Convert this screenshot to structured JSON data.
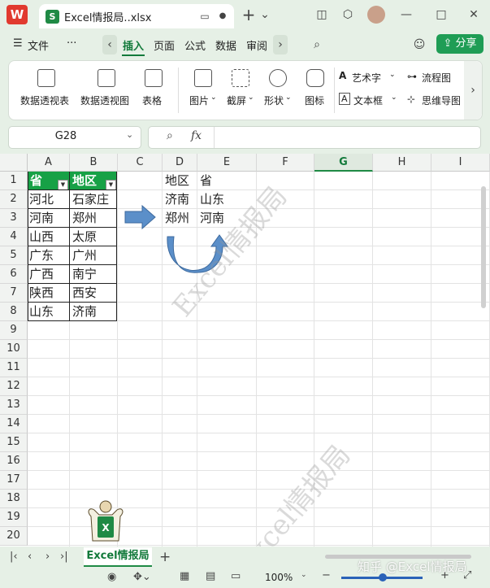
{
  "app": {
    "logo_letter": "W",
    "file_icon_letter": "S",
    "file_tab_title": "Excel情报局..xlsx",
    "new_tab_symbol": "+",
    "new_tab_menu": "⌄"
  },
  "menubar": {
    "hamburger": "☰",
    "file": "文件",
    "more": "···",
    "tabs": [
      "插入",
      "页面",
      "公式",
      "数据",
      "审阅"
    ],
    "active_tab": "插入",
    "share": "分享"
  },
  "ribbon": {
    "items": [
      {
        "label": "数据透视表",
        "icon": "pivot-table-icon"
      },
      {
        "label": "数据透视图",
        "icon": "pivot-chart-icon"
      },
      {
        "label": "表格",
        "icon": "table-icon"
      },
      {
        "label": "图片",
        "icon": "picture-icon"
      },
      {
        "label": "截屏",
        "icon": "screenshot-icon"
      },
      {
        "label": "形状",
        "icon": "shape-icon"
      },
      {
        "label": "图标",
        "icon": "icons-icon"
      }
    ],
    "right_items": [
      {
        "label": "艺术字",
        "icon": "art-text-icon"
      },
      {
        "label": "流程图",
        "icon": "flowchart-icon"
      },
      {
        "label": "文本框",
        "icon": "textbox-icon"
      },
      {
        "label": "思维导图",
        "icon": "mindmap-icon"
      }
    ]
  },
  "formula": {
    "name_box": "G28",
    "fx_label": "fx",
    "value": ""
  },
  "grid": {
    "columns": [
      "A",
      "B",
      "C",
      "D",
      "E",
      "F",
      "G",
      "H",
      "I"
    ],
    "selected_column": "G",
    "rows": [
      "1",
      "2",
      "3",
      "4",
      "5",
      "6",
      "7",
      "8",
      "9",
      "10",
      "11",
      "12",
      "13",
      "14",
      "15",
      "16",
      "17",
      "18",
      "19",
      "20"
    ],
    "table1": {
      "headers": [
        "省",
        "地区"
      ],
      "rows": [
        [
          "河北",
          "石家庄"
        ],
        [
          "河南",
          "郑州"
        ],
        [
          "山西",
          "太原"
        ],
        [
          "广东",
          "广州"
        ],
        [
          "广西",
          "南宁"
        ],
        [
          "陕西",
          "西安"
        ],
        [
          "山东",
          "济南"
        ]
      ]
    },
    "table2": {
      "headers": [
        "地区",
        "省"
      ],
      "rows": [
        [
          "济南",
          "山东"
        ],
        [
          "郑州",
          "河南"
        ]
      ]
    },
    "watermark": "Excel情报局",
    "accent_color": "#17a146"
  },
  "sheets": {
    "active": "Excel情报局",
    "add_symbol": "+"
  },
  "status": {
    "zoom": "100%",
    "credit": "知乎 @Excel情报局"
  }
}
